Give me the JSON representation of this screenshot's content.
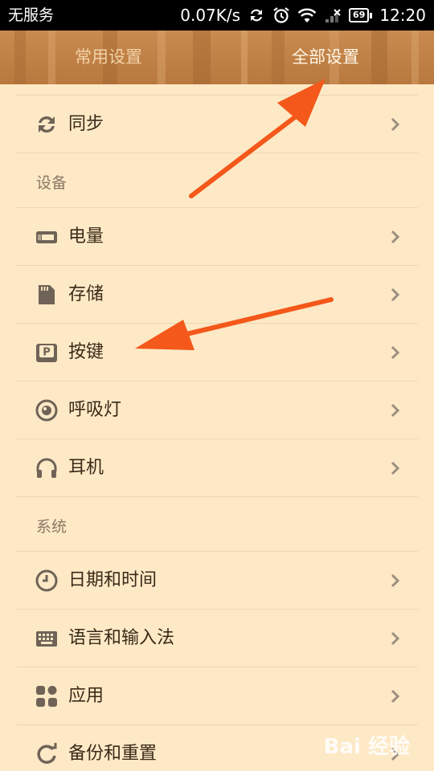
{
  "status_bar": {
    "carrier": "无服务",
    "speed": "0.07K/s",
    "battery": "69",
    "time": "12:20"
  },
  "tabs": {
    "common": "常用设置",
    "all": "全部设置"
  },
  "items": {
    "sync": "同步",
    "battery": "电量",
    "storage": "存储",
    "buttons": "按键",
    "breathing_light": "呼吸灯",
    "headset": "耳机",
    "date_time": "日期和时间",
    "language_input": "语言和输入法",
    "apps": "应用",
    "backup_reset": "备份和重置"
  },
  "sections": {
    "device": "设备",
    "system": "系统"
  },
  "watermark": "Bai 经验",
  "colors": {
    "background": "#fde9c6",
    "tabbar": "#c08248",
    "icon": "#6f6357",
    "annotation_arrow": "#f4581a"
  }
}
